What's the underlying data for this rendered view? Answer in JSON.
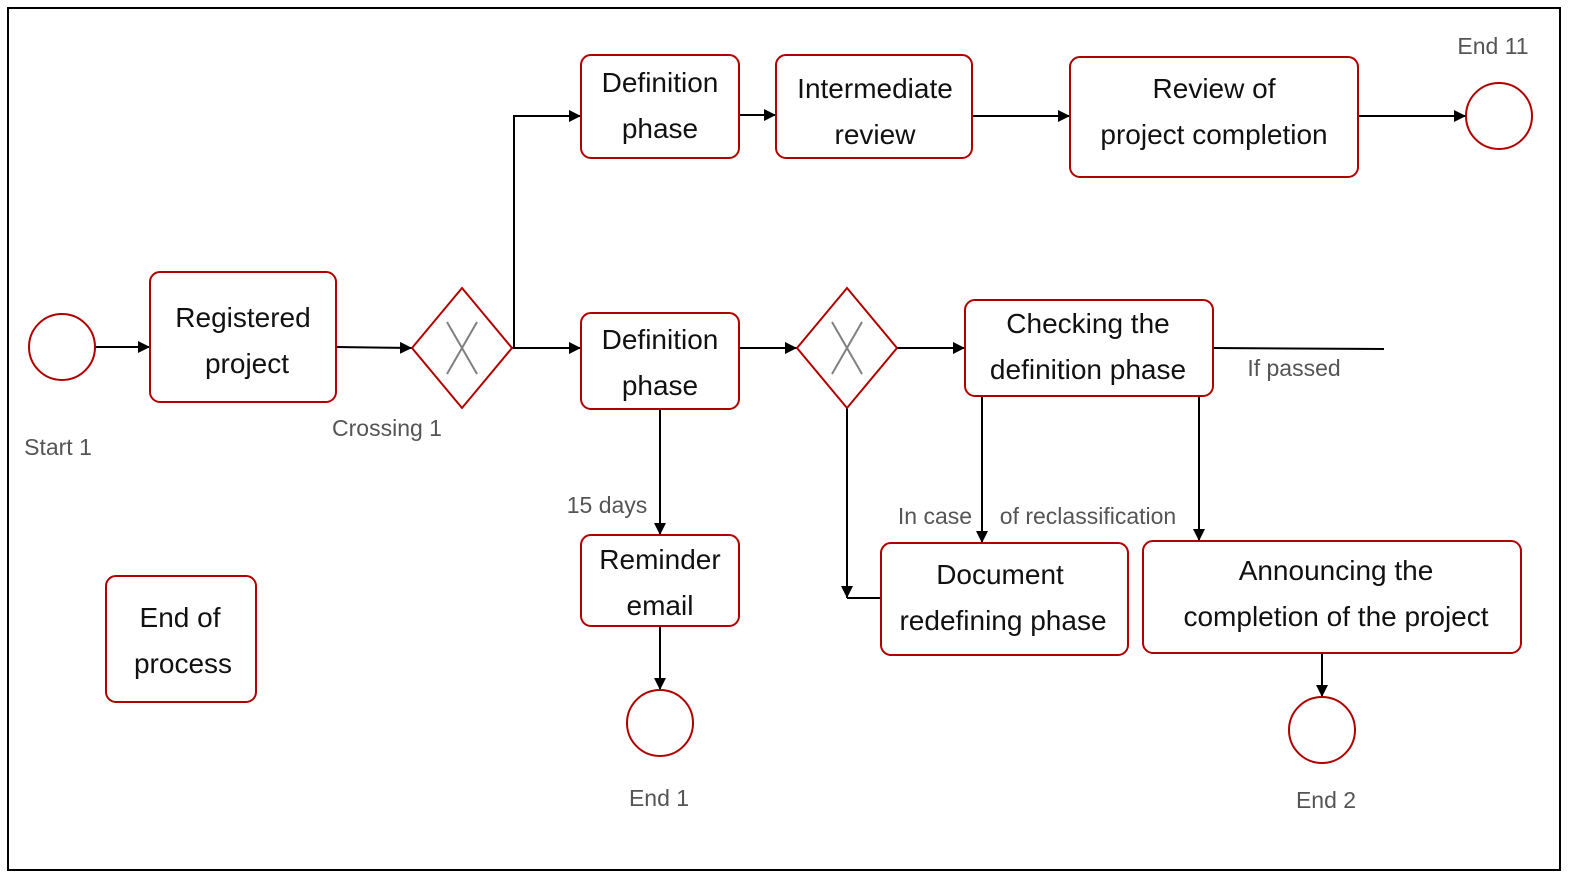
{
  "colors": {
    "node_stroke": "#b00000",
    "edge": "#000000",
    "label": "#555555",
    "gateway_mark": "#808080"
  },
  "nodes": {
    "registered": [
      "Registered",
      "project"
    ],
    "definition_top": [
      "Definition",
      "phase"
    ],
    "intermediate": [
      "Intermediate",
      "review"
    ],
    "review_completion": [
      "Review of",
      "project completion"
    ],
    "definition_mid": [
      "Definition",
      "phase"
    ],
    "checking": [
      "Checking the",
      "definition phase"
    ],
    "reminder": [
      "Reminder",
      "email"
    ],
    "document": [
      "Document",
      "redefining phase"
    ],
    "announcing": [
      "Announcing the",
      "completion of the project"
    ],
    "end_of_process": [
      "End of",
      "process"
    ]
  },
  "labels": {
    "start1": "Start 1",
    "crossing1": "Crossing 1",
    "end11": "End 11",
    "days15": "15 days",
    "in_case": "In case",
    "reclass": "of reclassification",
    "if_passed": "If passed",
    "end1": "End 1",
    "end2": "End 2"
  }
}
